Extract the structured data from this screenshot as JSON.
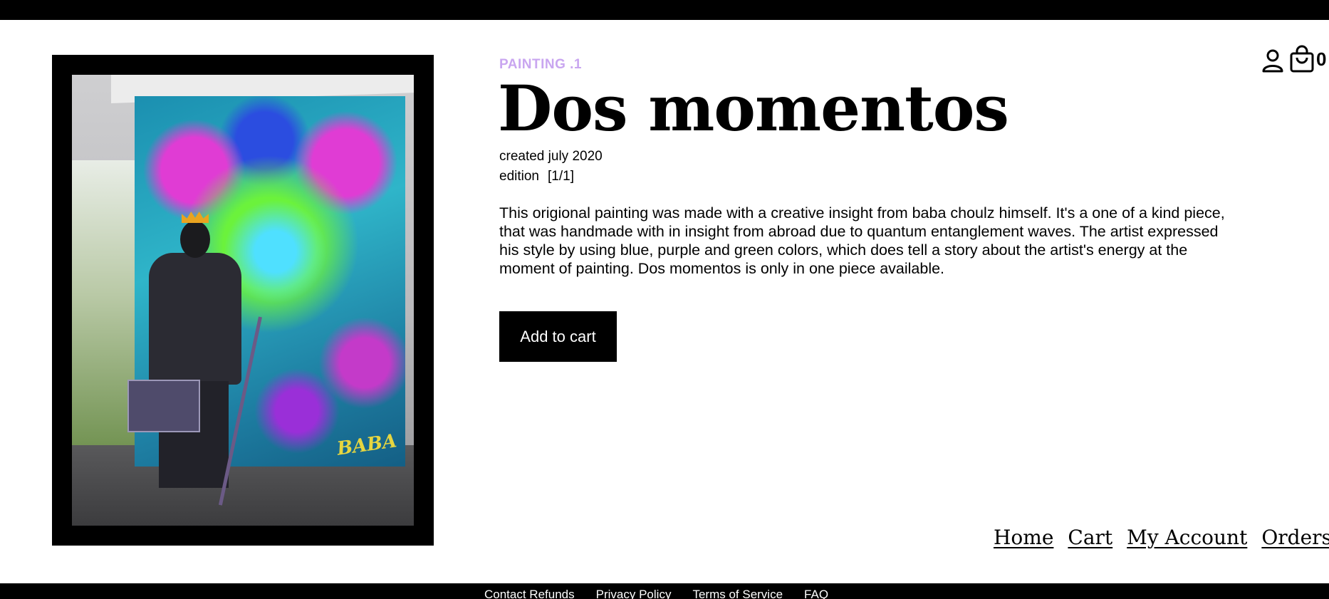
{
  "product": {
    "category": "PAINTING .1",
    "title": "Dos momentos",
    "created": "created july 2020",
    "edition_label": "edition",
    "edition_value": "[1/1]",
    "description": "This origional painting was made with a creative insight from baba choulz himself. It's a one of a kind piece, that was handmade with in insight from abroad due to quantum entanglement waves. The artist expressed his style by using blue, purple and green colors, which does tell a story about the artist's energy at the moment of painting. Dos momentos is only in one piece available.",
    "add_to_cart_label": "Add to cart",
    "image_signature": "BABA"
  },
  "header": {
    "account_icon": "user-icon",
    "cart_icon": "shopping-bag-icon",
    "cart_count": "0"
  },
  "nav": {
    "links": [
      "Home",
      "Cart",
      "My Account",
      "Orders"
    ]
  },
  "footer": {
    "links": [
      "Contact Refunds",
      "Privacy Policy",
      "Terms of Service",
      "FAQ"
    ]
  },
  "colors": {
    "category_accent": "#c9a6f0",
    "button_bg": "#000000",
    "bars": "#000000"
  }
}
